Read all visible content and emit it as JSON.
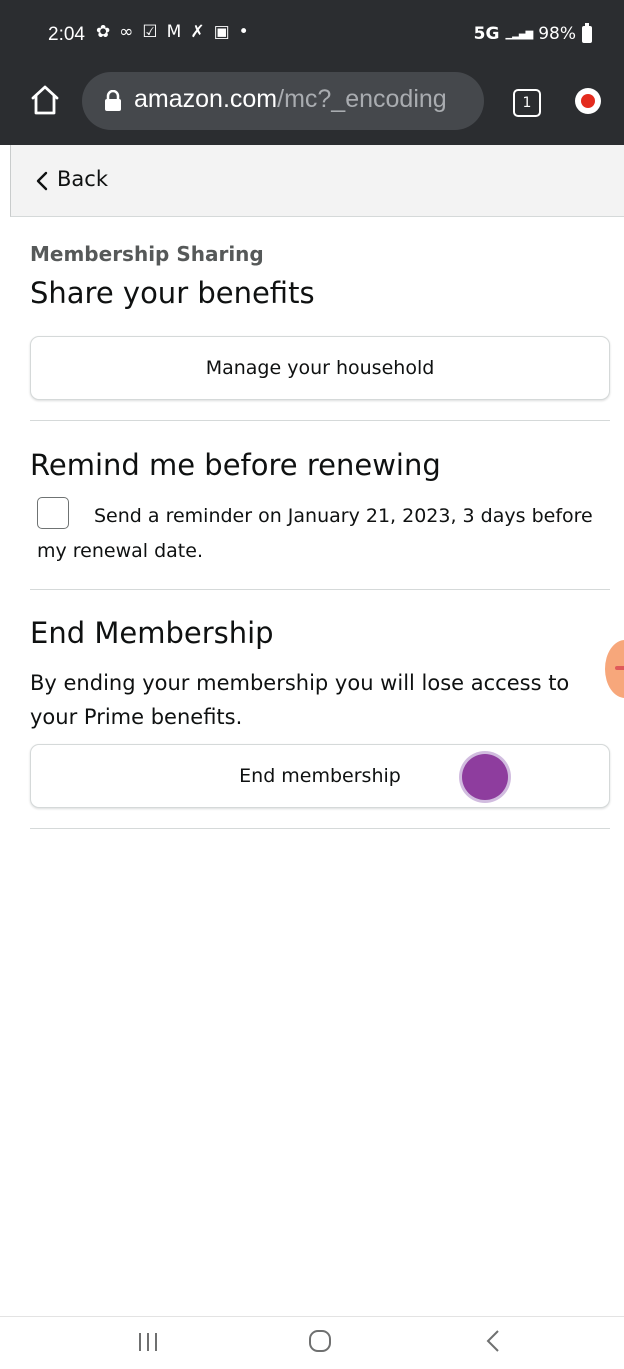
{
  "status_bar": {
    "time": "2:04",
    "network": "5G",
    "battery": "98%",
    "icons": [
      "settings-icon",
      "voicemail-icon",
      "check-box-icon",
      "gmail-icon",
      "missed-call-icon",
      "gallery-icon",
      "dot-icon"
    ]
  },
  "browser": {
    "url_host": "amazon.com",
    "url_path": "/mc?_encoding",
    "tab_count": "1"
  },
  "back_bar": {
    "label": "Back"
  },
  "sharing": {
    "kicker": "Membership Sharing",
    "title": "Share your benefits",
    "button": "Manage your household"
  },
  "reminder": {
    "title": "Remind me before renewing",
    "checkbox_label": "Send a reminder on January 21, 2023, 3 days before my renewal date.",
    "checked": false
  },
  "end_membership": {
    "title": "End Membership",
    "description": "By ending your membership you will lose access to your Prime benefits.",
    "button": "End membership"
  },
  "colors": {
    "chrome_bg": "#2b2d30",
    "urlbar_bg": "#45484c",
    "back_bar_bg": "#f3f3f3",
    "touch_indicator": "#8e3d9e"
  }
}
